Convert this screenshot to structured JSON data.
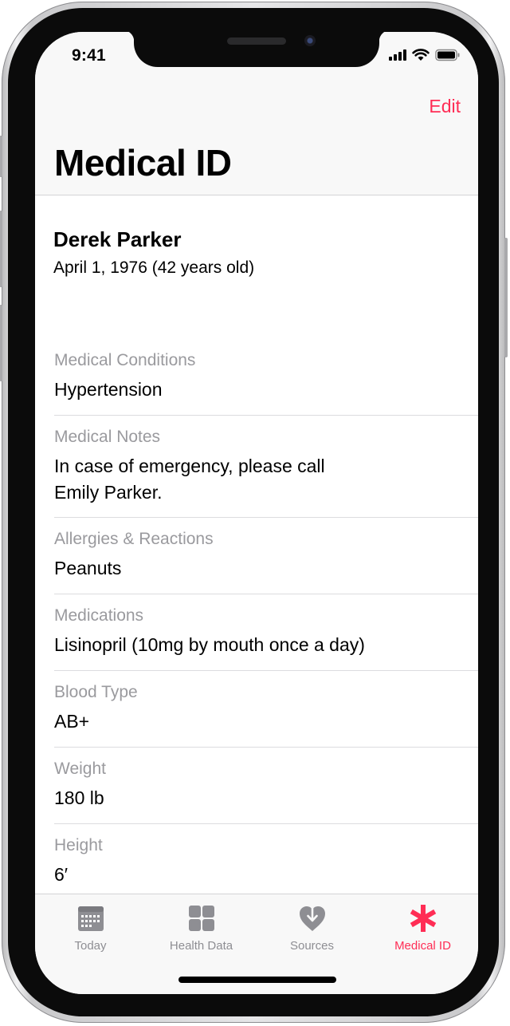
{
  "status_bar": {
    "time": "9:41"
  },
  "nav": {
    "edit_label": "Edit",
    "title": "Medical ID"
  },
  "profile": {
    "name": "Derek Parker",
    "birthdate": "April 1, 1976 (42 years old)"
  },
  "fields": [
    {
      "label": "Medical Conditions",
      "value": "Hypertension"
    },
    {
      "label": "Medical Notes",
      "value": "In case of emergency, please call\nEmily Parker."
    },
    {
      "label": "Allergies & Reactions",
      "value": "Peanuts"
    },
    {
      "label": "Medications",
      "value": "Lisinopril (10mg by mouth once a day)"
    },
    {
      "label": "Blood Type",
      "value": "AB+"
    },
    {
      "label": "Weight",
      "value": "180 lb"
    },
    {
      "label": "Height",
      "value": "6′"
    }
  ],
  "tabs": [
    {
      "label": "Today",
      "icon": "calendar-icon",
      "active": false
    },
    {
      "label": "Health Data",
      "icon": "grid-icon",
      "active": false
    },
    {
      "label": "Sources",
      "icon": "heart-download-icon",
      "active": false
    },
    {
      "label": "Medical ID",
      "icon": "asterisk-icon",
      "active": true
    }
  ],
  "colors": {
    "accent": "#ff2d55",
    "inactive": "#8e8e93",
    "secondary_text": "#9a9a9e"
  }
}
